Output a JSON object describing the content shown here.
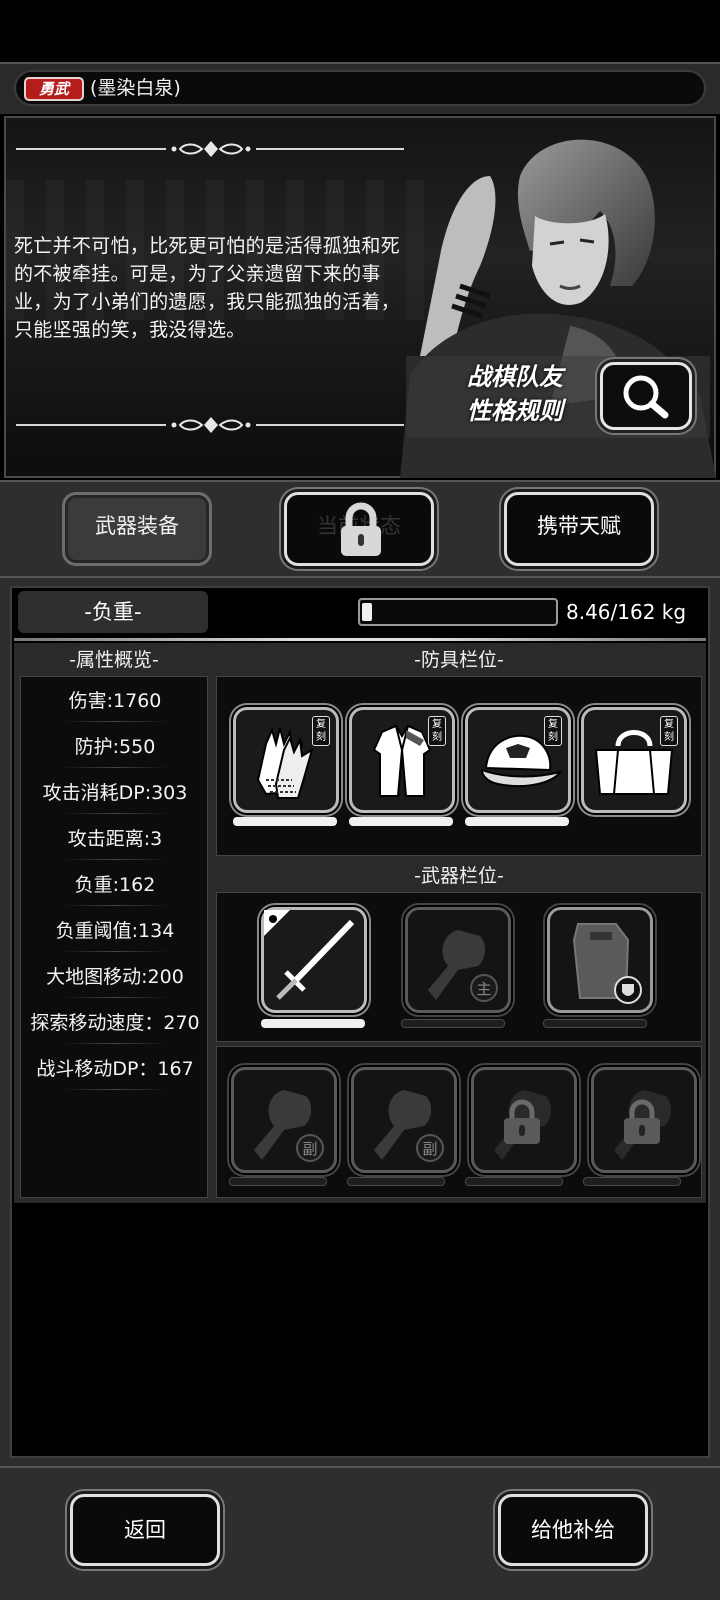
{
  "character": {
    "title_badge": "勇武",
    "name": "(墨染白泉)"
  },
  "story": {
    "quote": "死亡并不可怕，比死更可怕的是活得孤独和死的不被牵挂。可是，为了父亲遗留下来的事业，为了小弟们的遗愿，我只能孤独的活着，只能坚强的笑，我没得选。",
    "rules_line1": "战棋队友",
    "rules_line2": "性格规则"
  },
  "tabs": [
    {
      "label": "武器装备",
      "state": "active"
    },
    {
      "label": "当前状态",
      "state": "locked"
    },
    {
      "label": "携带天赋",
      "state": "normal"
    }
  ],
  "weight": {
    "tab_label": "-负重-",
    "text": "8.46/162 kg",
    "fraction": 0.052
  },
  "stats": {
    "title": "-属性概览-",
    "items": [
      "伤害:1760",
      "防护:550",
      "攻击消耗DP:303",
      "攻击距离:3",
      "负重:162",
      "负重阈值:134",
      "大地图移动:200",
      "探索移动速度：270",
      "战斗移动DP：167"
    ]
  },
  "armor": {
    "title": "-防具栏位-",
    "slots": [
      {
        "icon": "gloves-icon",
        "tag": "复刻"
      },
      {
        "icon": "coat-icon",
        "tag": "复刻"
      },
      {
        "icon": "cap-icon",
        "tag": "复刻"
      },
      {
        "icon": "bag-icon",
        "tag": "复刻"
      }
    ]
  },
  "weapons": {
    "title": "-武器栏位-",
    "slots": [
      {
        "icon": "sword-icon",
        "badge": ""
      },
      {
        "icon": "fist-icon",
        "badge": "主"
      },
      {
        "icon": "riot-shield-icon",
        "badge": ""
      }
    ],
    "secondary": [
      {
        "icon": "fist-icon",
        "badge": "副"
      },
      {
        "icon": "fist-icon",
        "badge": "副"
      },
      {
        "icon": "locked-slot-icon",
        "badge": ""
      },
      {
        "icon": "locked-slot-icon",
        "badge": ""
      }
    ]
  },
  "bottom": {
    "back_label": "返回",
    "supply_label": "给他补给"
  },
  "colors": {
    "badge_red": "#b51d1d",
    "panel_gray": "#2e2e2e",
    "frame_light": "#e0e0e0"
  }
}
